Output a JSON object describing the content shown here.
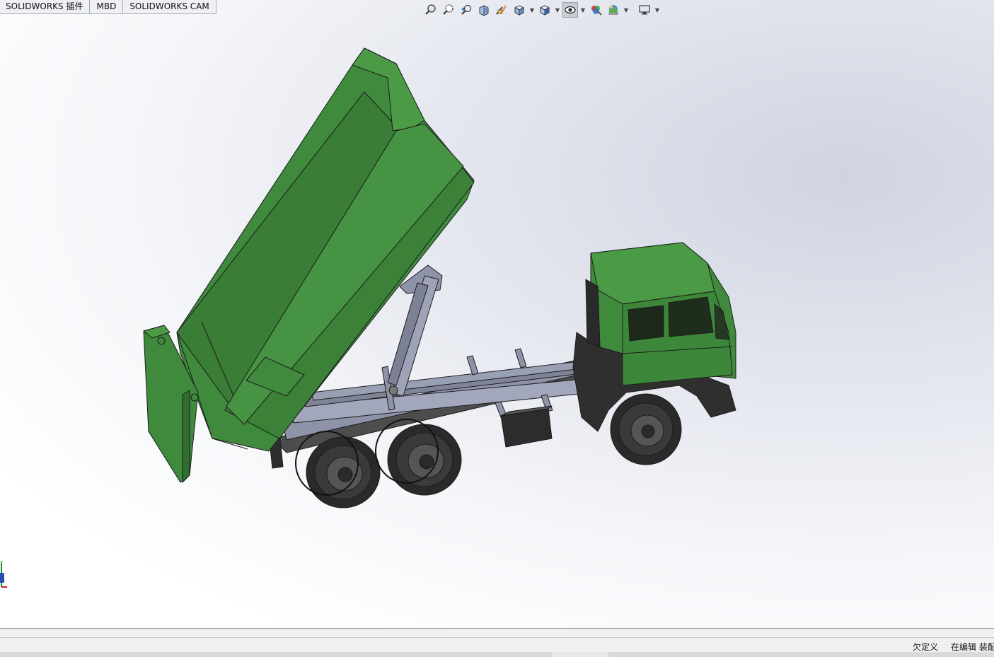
{
  "tabs": [
    {
      "label": "SOLIDWORKS 插件"
    },
    {
      "label": "MBD"
    },
    {
      "label": "SOLIDWORKS CAM"
    }
  ],
  "heads_up_toolbar": {
    "icons": [
      "zoom-to-fit-icon",
      "zoom-to-area-icon",
      "previous-view-icon",
      "section-view-icon",
      "dynamic-annotation-icon",
      "view-orientation-icon",
      "display-style-icon",
      "hide-show-items-icon",
      "edit-appearance-icon",
      "apply-scene-icon",
      "view-settings-icon"
    ],
    "active": "hide-show-items-icon"
  },
  "status_bar": {
    "state": "欠定义",
    "mode": "在编辑 装配"
  },
  "colors": {
    "body_green": "#3f8a3c",
    "body_green_light": "#4a9a46",
    "body_green_dark": "#2f6e2d",
    "frame_gray": "#8e93a8",
    "tire_black": "#2a2a2a"
  }
}
